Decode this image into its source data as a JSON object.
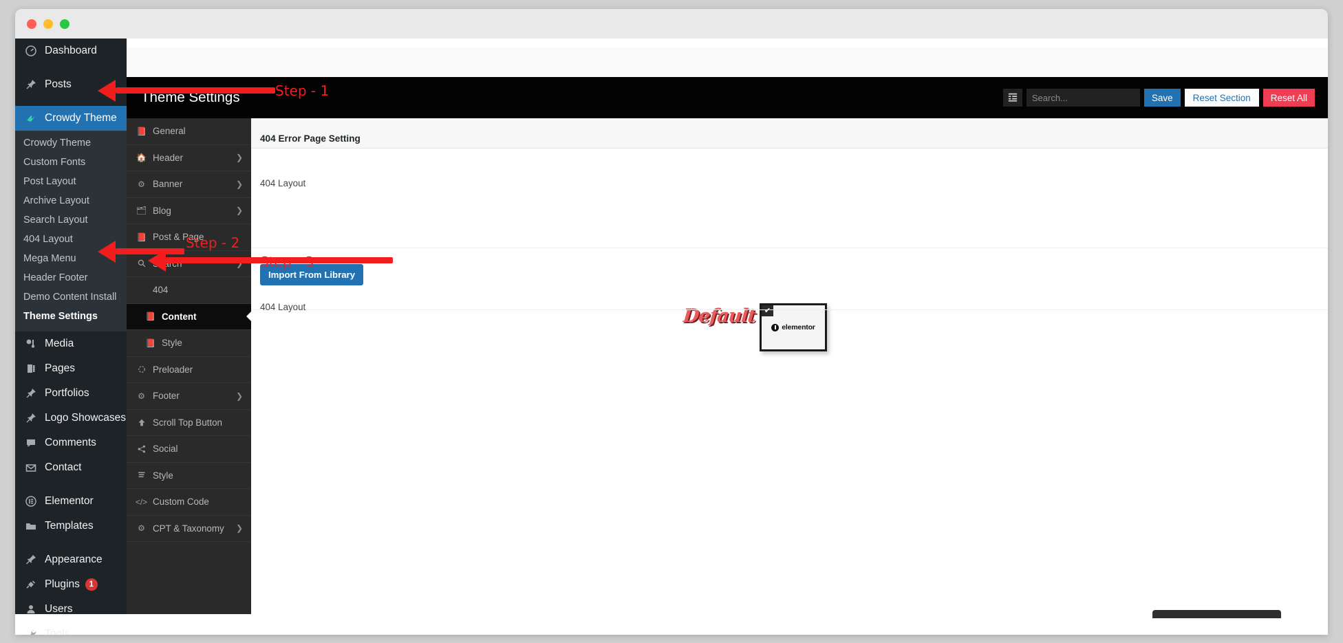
{
  "window": {
    "traffic_lights": [
      "close",
      "minimize",
      "maximize"
    ]
  },
  "wp_sidebar": {
    "items": [
      {
        "label": "Dashboard",
        "icon": "dashboard-icon",
        "active": false
      },
      {
        "label": "Posts",
        "icon": "pin-icon",
        "active": false
      },
      {
        "label": "Crowdy Theme",
        "icon": "crowdy-icon",
        "active": true
      },
      {
        "label": "Media",
        "icon": "media-icon",
        "active": false
      },
      {
        "label": "Pages",
        "icon": "pages-icon",
        "active": false
      },
      {
        "label": "Portfolios",
        "icon": "pin-icon",
        "active": false
      },
      {
        "label": "Logo Showcases",
        "icon": "pin-icon",
        "active": false
      },
      {
        "label": "Comments",
        "icon": "comment-icon",
        "active": false
      },
      {
        "label": "Contact",
        "icon": "mail-icon",
        "active": false
      },
      {
        "label": "Elementor",
        "icon": "elementor-icon",
        "active": false
      },
      {
        "label": "Templates",
        "icon": "folder-icon",
        "active": false
      },
      {
        "label": "Appearance",
        "icon": "brush-icon",
        "active": false
      },
      {
        "label": "Plugins",
        "icon": "plug-icon",
        "active": false,
        "badge": "1"
      },
      {
        "label": "Users",
        "icon": "user-icon",
        "active": false
      },
      {
        "label": "Tools",
        "icon": "wrench-icon",
        "active": false
      }
    ],
    "submenu": [
      {
        "label": "Crowdy Theme",
        "current": false
      },
      {
        "label": "Custom Fonts",
        "current": false
      },
      {
        "label": "Post Layout",
        "current": false
      },
      {
        "label": "Archive Layout",
        "current": false
      },
      {
        "label": "Search Layout",
        "current": false
      },
      {
        "label": "404 Layout",
        "current": false
      },
      {
        "label": "Mega Menu",
        "current": false
      },
      {
        "label": "Header Footer",
        "current": false
      },
      {
        "label": "Demo Content Install",
        "current": false
      },
      {
        "label": "Theme Settings",
        "current": true
      }
    ]
  },
  "header": {
    "title": "Theme Settings",
    "expand_icon": "collapse-panel-icon",
    "search_placeholder": "Search...",
    "search_value": "",
    "save_label": "Save",
    "reset_section_label": "Reset Section",
    "reset_all_label": "Reset All",
    "colors": {
      "save": "#2271b1",
      "reset_all": "#ef3e53",
      "background": "#030303"
    }
  },
  "settings_nav": [
    {
      "label": "General",
      "icon": "book-icon",
      "chevron": false,
      "level": "top",
      "active": false
    },
    {
      "label": "Header",
      "icon": "home-icon",
      "chevron": true,
      "level": "top",
      "active": false
    },
    {
      "label": "Banner",
      "icon": "gear-icon",
      "chevron": true,
      "level": "top",
      "active": false
    },
    {
      "label": "Blog",
      "icon": "archive-icon",
      "chevron": true,
      "level": "top",
      "active": false
    },
    {
      "label": "Post & Page",
      "icon": "book-icon",
      "chevron": false,
      "level": "top",
      "active": false
    },
    {
      "label": "Search",
      "icon": "search-icon",
      "chevron": true,
      "level": "top",
      "active": false
    },
    {
      "label": "404",
      "icon": "none",
      "chevron": false,
      "level": "top",
      "active": false
    },
    {
      "label": "Content",
      "icon": "book-icon",
      "chevron": false,
      "level": "sub",
      "active": true
    },
    {
      "label": "Style",
      "icon": "book-icon",
      "chevron": false,
      "level": "sub",
      "active": false
    },
    {
      "label": "Preloader",
      "icon": "spinner-icon",
      "chevron": false,
      "level": "top",
      "active": false
    },
    {
      "label": "Footer",
      "icon": "gear-icon",
      "chevron": true,
      "level": "top",
      "active": false
    },
    {
      "label": "Scroll Top Button",
      "icon": "arrow-up-icon",
      "chevron": false,
      "level": "top",
      "active": false
    },
    {
      "label": "Social",
      "icon": "share-icon",
      "chevron": false,
      "level": "top",
      "active": false
    },
    {
      "label": "Style",
      "icon": "css3-icon",
      "chevron": false,
      "level": "top",
      "active": false
    },
    {
      "label": "Custom Code",
      "icon": "code-icon",
      "chevron": false,
      "level": "top",
      "active": false
    },
    {
      "label": "CPT & Taxonomy",
      "icon": "gear-icon",
      "chevron": true,
      "level": "top",
      "active": false
    }
  ],
  "main": {
    "section_title": "404 Error Page Setting",
    "layout_field_label": "404 Layout",
    "default_badge": "Default",
    "layout_card": {
      "checked_icon": "check-icon",
      "logo_text": "elementor"
    },
    "import_button_label": "Import From Library",
    "import_caption": "404 Layout"
  },
  "annotations": {
    "step1": "Step - 1",
    "step2": "Step - 2",
    "step3": "Step - 3",
    "arrow_color": "#f41d1d"
  }
}
